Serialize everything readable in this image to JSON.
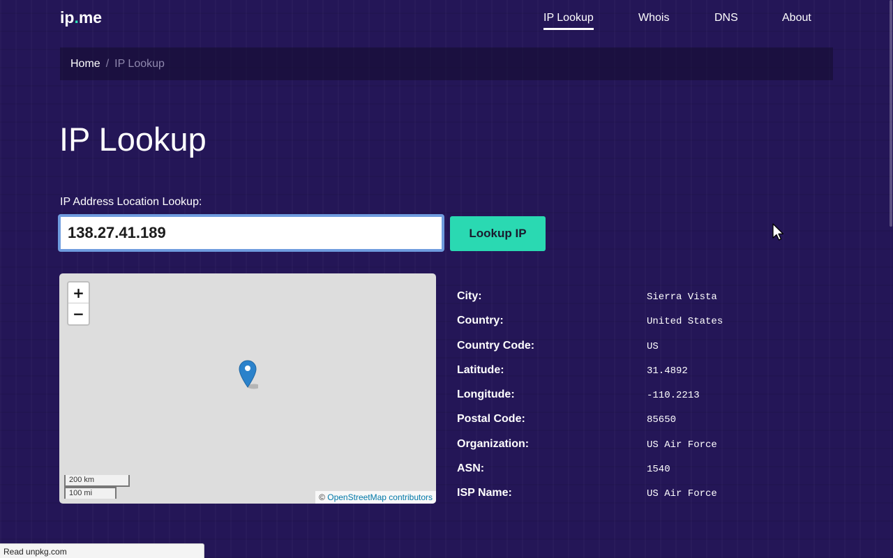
{
  "brand": {
    "prefix": "ip",
    "dot": ".",
    "suffix": "me"
  },
  "nav": [
    {
      "label": "IP Lookup",
      "active": true
    },
    {
      "label": "Whois",
      "active": false
    },
    {
      "label": "DNS",
      "active": false
    },
    {
      "label": "About",
      "active": false
    }
  ],
  "breadcrumb": {
    "home": "Home",
    "separator": "/",
    "current": "IP Lookup"
  },
  "page": {
    "title": "IP Lookup",
    "lookup_label": "IP Address Location Lookup:",
    "ip_value": "138.27.41.189",
    "button_label": "Lookup IP"
  },
  "map": {
    "zoom_in": "+",
    "zoom_out": "−",
    "scale_km": "200 km",
    "scale_mi": "100 mi",
    "attribution_prefix": "©",
    "attribution_link": "OpenStreetMap contributors",
    "marker_color": "#2b82cb"
  },
  "details": [
    {
      "label": "City:",
      "value": "Sierra Vista"
    },
    {
      "label": "Country:",
      "value": "United States"
    },
    {
      "label": "Country Code:",
      "value": "US"
    },
    {
      "label": "Latitude:",
      "value": "31.4892"
    },
    {
      "label": "Longitude:",
      "value": "-110.2213"
    },
    {
      "label": "Postal Code:",
      "value": "85650"
    },
    {
      "label": "Organization:",
      "value": "US Air Force"
    },
    {
      "label": "ASN:",
      "value": "1540"
    },
    {
      "label": "ISP Name:",
      "value": "US Air Force"
    }
  ],
  "status_bar": "Read unpkg.com",
  "colors": {
    "background": "#241657",
    "accent": "#2ad9b2",
    "input_focus": "#6f9cde"
  }
}
